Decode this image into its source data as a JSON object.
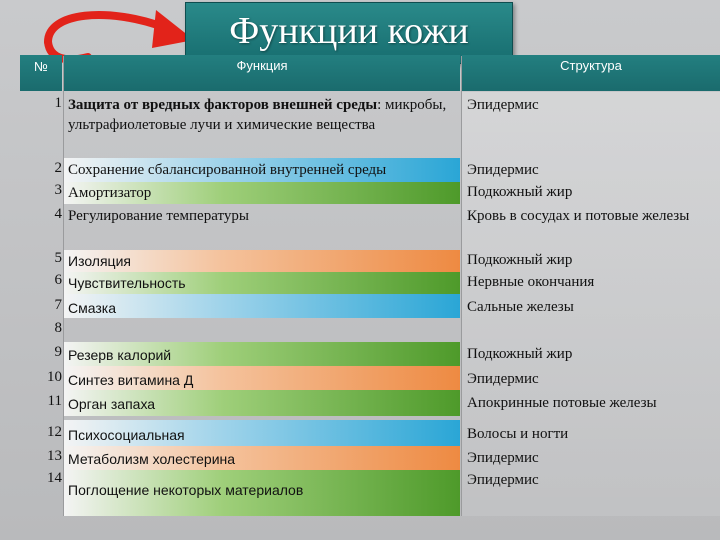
{
  "title": "Функции кожи",
  "headers": {
    "num": "№",
    "function": "Функция",
    "structure": "Структура"
  },
  "rows": [
    {
      "num": "1",
      "func_bold": "Защита от вредных факторов внешней среды",
      "func": ": микробы, ультрафиолетовые лучи и химические вещества",
      "structure": "Эпидермис"
    },
    {
      "num": "2",
      "func": "Сохранение сбалансированной внутренней среды",
      "structure": "Эпидермис"
    },
    {
      "num": "3",
      "func": "Амортизатор",
      "structure": "Подкожный жир"
    },
    {
      "num": "4",
      "func": "Регулирование температуры",
      "structure": "Кровь  в сосудах и потовые железы"
    },
    {
      "num": "5",
      "func": "Изоляция",
      "structure": "Подкожный жир"
    },
    {
      "num": "6",
      "func": "Чувствительность",
      "structure": "Нервные окончания"
    },
    {
      "num": "7",
      "func": "Смазка",
      "structure": "Сальные железы"
    },
    {
      "num": "8",
      "func": "",
      "structure": ""
    },
    {
      "num": "9",
      "func": "Резерв калорий",
      "structure": "Подкожный жир"
    },
    {
      "num": "10",
      "func": "Синтез витамина Д",
      "structure": "Эпидермис"
    },
    {
      "num": "11",
      "func": "Орган запаха",
      "structure": "Апокринные потовые железы"
    },
    {
      "num": "12",
      "func": "Психосоциальная",
      "structure": "Волосы и ногти"
    },
    {
      "num": "13",
      "func": "Метаболизм холестерина",
      "structure": "Эпидермис"
    },
    {
      "num": "14",
      "func": "Поглощение некоторых материалов",
      "structure": "Эпидермис"
    }
  ],
  "colors": {
    "header": "#1f7577",
    "arrow": "#e2231a"
  }
}
